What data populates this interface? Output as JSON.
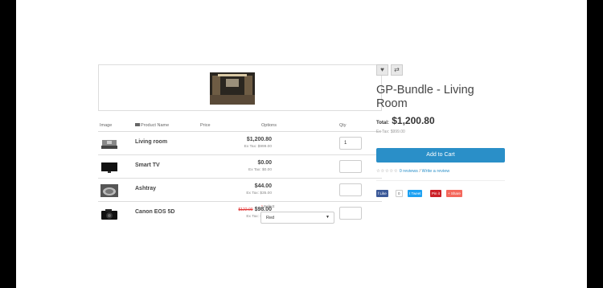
{
  "product": {
    "title": "GP-Bundle - Living Room",
    "total_label": "Total:",
    "total_value": "$1,200.80",
    "ex_tax": "Ex Tax: $999.00",
    "add_to_cart": "Add to Cart",
    "reviews_link": "0 reviews",
    "review_separator": "/",
    "write_review": "Write a review",
    "rating_stars": 0
  },
  "actions": {
    "wishlist_icon": "heart-icon",
    "compare_icon": "compare-icon"
  },
  "share": {
    "facebook": "Like",
    "facebook_count": "0",
    "twitter": "Tweet",
    "pinterest": "Pin it",
    "other": "Share"
  },
  "table": {
    "headers": [
      "Image",
      "Product Name",
      "Price",
      "Options",
      "Qty"
    ],
    "rows": [
      {
        "name": "Living room",
        "price": "$1,200.80",
        "ex_tax": "Ex Tax: $999.00",
        "qty": "1",
        "image": "living-room-thumbnail"
      },
      {
        "name": "Smart TV",
        "price": "$0.00",
        "ex_tax": "Ex Tax: $0.00",
        "qty": "",
        "image": "smart-tv-thumbnail"
      },
      {
        "name": "Ashtray",
        "price": "$44.00",
        "ex_tax": "Ex Tax: $35.00",
        "qty": "",
        "image": "ashtray-thumbnail"
      },
      {
        "name": "Canon EOS 5D",
        "old_price": "$122.00",
        "price": "$98.00",
        "ex_tax": "Ex Tax: $80.00",
        "qty": "",
        "image": "camera-thumbnail",
        "option_label": "Select",
        "option_value": "Red"
      }
    ]
  },
  "colors": {
    "accent": "#2a8fc8",
    "sale": "#e03030",
    "facebook": "#3b5998",
    "twitter": "#1da1f2",
    "pinterest": "#cb2027",
    "share": "#f4685c"
  }
}
